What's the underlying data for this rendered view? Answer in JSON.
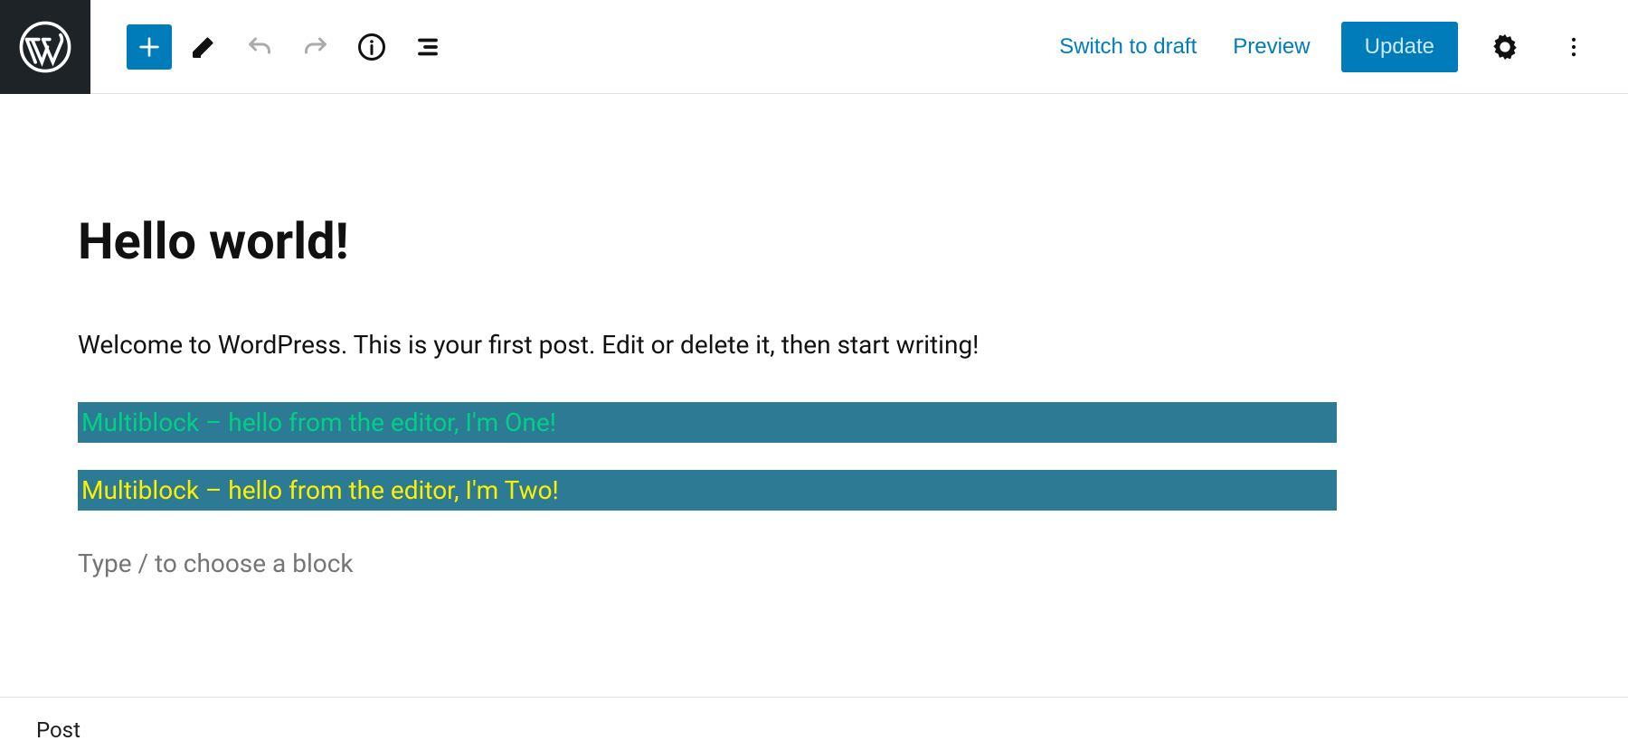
{
  "toolbar": {
    "switch_to_draft": "Switch to draft",
    "preview": "Preview",
    "update": "Update"
  },
  "post": {
    "title": "Hello world!",
    "paragraph": "Welcome to WordPress. This is your first post. Edit or delete it, then start writing!",
    "block_one": "Multiblock – hello from the editor, I'm One!",
    "block_two": "Multiblock – hello from the editor, I'm Two!",
    "prompt": "Type / to choose a block"
  },
  "footer": {
    "breadcrumb": "Post"
  },
  "colors": {
    "wp_blue": "#007cba",
    "block_bg": "#2d7a95",
    "block_one_text": "#00d084",
    "block_two_text": "#fcf000"
  }
}
